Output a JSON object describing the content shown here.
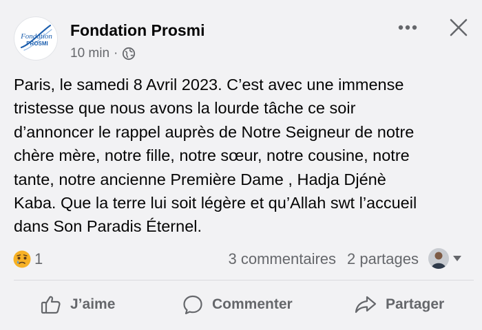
{
  "post": {
    "author": {
      "name": "Fondation Prosmi",
      "logo_text_top": "Fondation",
      "logo_text_bottom": "PROSMI"
    },
    "meta": {
      "time": "10 min",
      "separator": "·",
      "audience_icon": "globe-icon"
    },
    "header_icons": {
      "more": "more-horizontal-icon",
      "close": "close-icon"
    },
    "text": "Paris, le samedi 8 Avril 2023. C’est avec une immense\ntristesse que nous avons la lourde tâche ce soir\nd’annoncer le rappel auprès de Notre Seigneur de notre\nchère mère, notre fille, notre sœur, notre cousine, notre\ntante, notre ancienne Première Dame , Hadja Djénè\nKaba. Que la terre lui soit légère et qu’Allah swt l’accueil\ndans Son Paradis Éternel.",
    "reactions": {
      "icon": "sad-reaction-icon",
      "count": "1"
    },
    "comments_count": "3 commentaires",
    "shares_count": "2 partages",
    "audience_selector_icon": "chevron-down-icon"
  },
  "actions": {
    "like_label": "J’aime",
    "comment_label": "Commenter",
    "share_label": "Partager"
  },
  "colors": {
    "background": "#f2f2f4",
    "text_primary": "#050505",
    "text_secondary": "#65676b",
    "sad_emoji": "#f7b125",
    "logo_blue": "#1d5fae"
  }
}
